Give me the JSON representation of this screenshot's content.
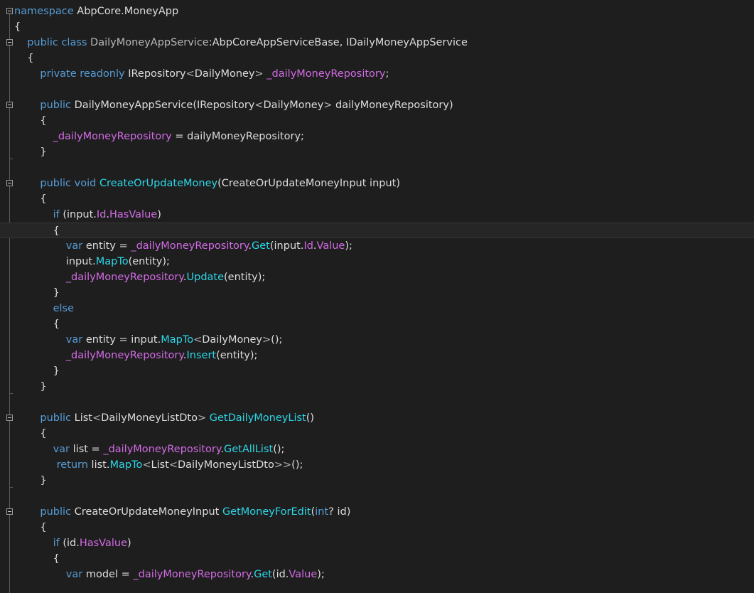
{
  "editor": {
    "lines": [
      {
        "indent": 0,
        "fold": true,
        "tokens": [
          {
            "t": "namespace",
            "c": "kw"
          },
          {
            "t": " AbpCore.MoneyApp",
            "c": "pl"
          }
        ]
      },
      {
        "indent": 0,
        "tokens": [
          {
            "t": "{",
            "c": "pl"
          }
        ]
      },
      {
        "indent": 1,
        "fold": true,
        "tokens": [
          {
            "t": "public",
            "c": "kw"
          },
          {
            "t": " ",
            "c": "pl"
          },
          {
            "t": "class",
            "c": "kw"
          },
          {
            "t": " ",
            "c": "pl"
          },
          {
            "t": "DailyMoneyAppService",
            "c": "ty"
          },
          {
            "t": ":AbpCoreAppServiceBase, IDailyMoneyAppService",
            "c": "pl"
          }
        ]
      },
      {
        "indent": 1,
        "tokens": [
          {
            "t": "{",
            "c": "pl"
          }
        ]
      },
      {
        "indent": 2,
        "tokens": [
          {
            "t": "private",
            "c": "kw"
          },
          {
            "t": " ",
            "c": "pl"
          },
          {
            "t": "readonly",
            "c": "kw"
          },
          {
            "t": " IRepository",
            "c": "pl"
          },
          {
            "t": "<",
            "c": "op"
          },
          {
            "t": "DailyMoney",
            "c": "pl"
          },
          {
            "t": ">",
            "c": "op"
          },
          {
            "t": " ",
            "c": "pl"
          },
          {
            "t": "_dailyMoneyRepository",
            "c": "fd"
          },
          {
            "t": ";",
            "c": "pl"
          }
        ]
      },
      {
        "indent": 0,
        "tokens": []
      },
      {
        "indent": 2,
        "fold": true,
        "tokens": [
          {
            "t": "public",
            "c": "kw"
          },
          {
            "t": " DailyMoneyAppService(IRepository",
            "c": "pl"
          },
          {
            "t": "<",
            "c": "op"
          },
          {
            "t": "DailyMoney",
            "c": "pl"
          },
          {
            "t": ">",
            "c": "op"
          },
          {
            "t": " dailyMoneyRepository)",
            "c": "pl"
          }
        ]
      },
      {
        "indent": 2,
        "tokens": [
          {
            "t": "{",
            "c": "pl"
          }
        ]
      },
      {
        "indent": 3,
        "tokens": [
          {
            "t": "_dailyMoneyRepository",
            "c": "fd"
          },
          {
            "t": " = dailyMoneyRepository;",
            "c": "pl"
          }
        ]
      },
      {
        "indent": 2,
        "tokens": [
          {
            "t": "}",
            "c": "pl"
          }
        ]
      },
      {
        "indent": 0,
        "tokens": []
      },
      {
        "indent": 2,
        "fold": true,
        "tokens": [
          {
            "t": "public",
            "c": "kw"
          },
          {
            "t": " ",
            "c": "pl"
          },
          {
            "t": "void",
            "c": "kw"
          },
          {
            "t": " ",
            "c": "pl"
          },
          {
            "t": "CreateOrUpdateMoney",
            "c": "me"
          },
          {
            "t": "(CreateOrUpdateMoneyInput input)",
            "c": "pl"
          }
        ]
      },
      {
        "indent": 2,
        "tokens": [
          {
            "t": "{",
            "c": "pl"
          }
        ]
      },
      {
        "indent": 3,
        "tokens": [
          {
            "t": "if",
            "c": "kw"
          },
          {
            "t": " (input.",
            "c": "pl"
          },
          {
            "t": "Id",
            "c": "fd"
          },
          {
            "t": ".",
            "c": "pl"
          },
          {
            "t": "HasValue",
            "c": "fd"
          },
          {
            "t": ")",
            "c": "pl"
          }
        ]
      },
      {
        "indent": 3,
        "current": true,
        "tokens": [
          {
            "t": "{",
            "c": "pl"
          }
        ]
      },
      {
        "indent": 4,
        "tokens": [
          {
            "t": "var",
            "c": "kw"
          },
          {
            "t": " entity = ",
            "c": "pl"
          },
          {
            "t": "_dailyMoneyRepository",
            "c": "fd"
          },
          {
            "t": ".",
            "c": "pl"
          },
          {
            "t": "Get",
            "c": "me"
          },
          {
            "t": "(input.",
            "c": "pl"
          },
          {
            "t": "Id",
            "c": "fd"
          },
          {
            "t": ".",
            "c": "pl"
          },
          {
            "t": "Value",
            "c": "fd"
          },
          {
            "t": ");",
            "c": "pl"
          }
        ]
      },
      {
        "indent": 4,
        "tokens": [
          {
            "t": "input.",
            "c": "pl"
          },
          {
            "t": "MapTo",
            "c": "me"
          },
          {
            "t": "(entity);",
            "c": "pl"
          }
        ]
      },
      {
        "indent": 4,
        "tokens": [
          {
            "t": "_dailyMoneyRepository",
            "c": "fd"
          },
          {
            "t": ".",
            "c": "pl"
          },
          {
            "t": "Update",
            "c": "me"
          },
          {
            "t": "(entity);",
            "c": "pl"
          }
        ]
      },
      {
        "indent": 3,
        "tokens": [
          {
            "t": "}",
            "c": "pl"
          }
        ]
      },
      {
        "indent": 3,
        "tokens": [
          {
            "t": "else",
            "c": "kw"
          }
        ]
      },
      {
        "indent": 3,
        "tokens": [
          {
            "t": "{",
            "c": "pl"
          }
        ]
      },
      {
        "indent": 4,
        "tokens": [
          {
            "t": "var",
            "c": "kw"
          },
          {
            "t": " entity = input.",
            "c": "pl"
          },
          {
            "t": "MapTo",
            "c": "me"
          },
          {
            "t": "<",
            "c": "op"
          },
          {
            "t": "DailyMoney",
            "c": "pl"
          },
          {
            "t": ">",
            "c": "op"
          },
          {
            "t": "();",
            "c": "pl"
          }
        ]
      },
      {
        "indent": 4,
        "tokens": [
          {
            "t": "_dailyMoneyRepository",
            "c": "fd"
          },
          {
            "t": ".",
            "c": "pl"
          },
          {
            "t": "Insert",
            "c": "me"
          },
          {
            "t": "(entity);",
            "c": "pl"
          }
        ]
      },
      {
        "indent": 3,
        "tokens": [
          {
            "t": "}",
            "c": "pl"
          }
        ]
      },
      {
        "indent": 2,
        "tokens": [
          {
            "t": "}",
            "c": "pl"
          }
        ]
      },
      {
        "indent": 0,
        "tokens": []
      },
      {
        "indent": 2,
        "fold": true,
        "tokens": [
          {
            "t": "public",
            "c": "kw"
          },
          {
            "t": " List",
            "c": "pl"
          },
          {
            "t": "<",
            "c": "op"
          },
          {
            "t": "DailyMoneyListDto",
            "c": "pl"
          },
          {
            "t": ">",
            "c": "op"
          },
          {
            "t": " ",
            "c": "pl"
          },
          {
            "t": "GetDailyMoneyList",
            "c": "me"
          },
          {
            "t": "()",
            "c": "pl"
          }
        ]
      },
      {
        "indent": 2,
        "tokens": [
          {
            "t": "{",
            "c": "pl"
          }
        ]
      },
      {
        "indent": 3,
        "tokens": [
          {
            "t": "var",
            "c": "kw"
          },
          {
            "t": " list = ",
            "c": "pl"
          },
          {
            "t": "_dailyMoneyRepository",
            "c": "fd"
          },
          {
            "t": ".",
            "c": "pl"
          },
          {
            "t": "GetAllList",
            "c": "me"
          },
          {
            "t": "();",
            "c": "pl"
          }
        ]
      },
      {
        "indent": 3,
        "pad": 1,
        "tokens": [
          {
            "t": "return",
            "c": "kw"
          },
          {
            "t": " list.",
            "c": "pl"
          },
          {
            "t": "MapTo",
            "c": "me"
          },
          {
            "t": "<",
            "c": "op"
          },
          {
            "t": "List",
            "c": "pl"
          },
          {
            "t": "<",
            "c": "op"
          },
          {
            "t": "DailyMoneyListDto",
            "c": "pl"
          },
          {
            "t": ">>",
            "c": "op"
          },
          {
            "t": "();",
            "c": "pl"
          }
        ]
      },
      {
        "indent": 2,
        "tokens": [
          {
            "t": "}",
            "c": "pl"
          }
        ]
      },
      {
        "indent": 0,
        "tokens": []
      },
      {
        "indent": 2,
        "fold": true,
        "tokens": [
          {
            "t": "public",
            "c": "kw"
          },
          {
            "t": " CreateOrUpdateMoneyInput ",
            "c": "pl"
          },
          {
            "t": "GetMoneyForEdit",
            "c": "me"
          },
          {
            "t": "(",
            "c": "pl"
          },
          {
            "t": "int",
            "c": "kw"
          },
          {
            "t": "? id)",
            "c": "pl"
          }
        ]
      },
      {
        "indent": 2,
        "tokens": [
          {
            "t": "{",
            "c": "pl"
          }
        ]
      },
      {
        "indent": 3,
        "tokens": [
          {
            "t": "if",
            "c": "kw"
          },
          {
            "t": " (id.",
            "c": "pl"
          },
          {
            "t": "HasValue",
            "c": "fd"
          },
          {
            "t": ")",
            "c": "pl"
          }
        ]
      },
      {
        "indent": 3,
        "tokens": [
          {
            "t": "{",
            "c": "pl"
          }
        ]
      },
      {
        "indent": 4,
        "tokens": [
          {
            "t": "var",
            "c": "kw"
          },
          {
            "t": " model = ",
            "c": "pl"
          },
          {
            "t": "_dailyMoneyRepository",
            "c": "fd"
          },
          {
            "t": ".",
            "c": "pl"
          },
          {
            "t": "Get",
            "c": "me"
          },
          {
            "t": "(id.",
            "c": "pl"
          },
          {
            "t": "Value",
            "c": "fd"
          },
          {
            "t": ");",
            "c": "pl"
          }
        ]
      }
    ]
  }
}
